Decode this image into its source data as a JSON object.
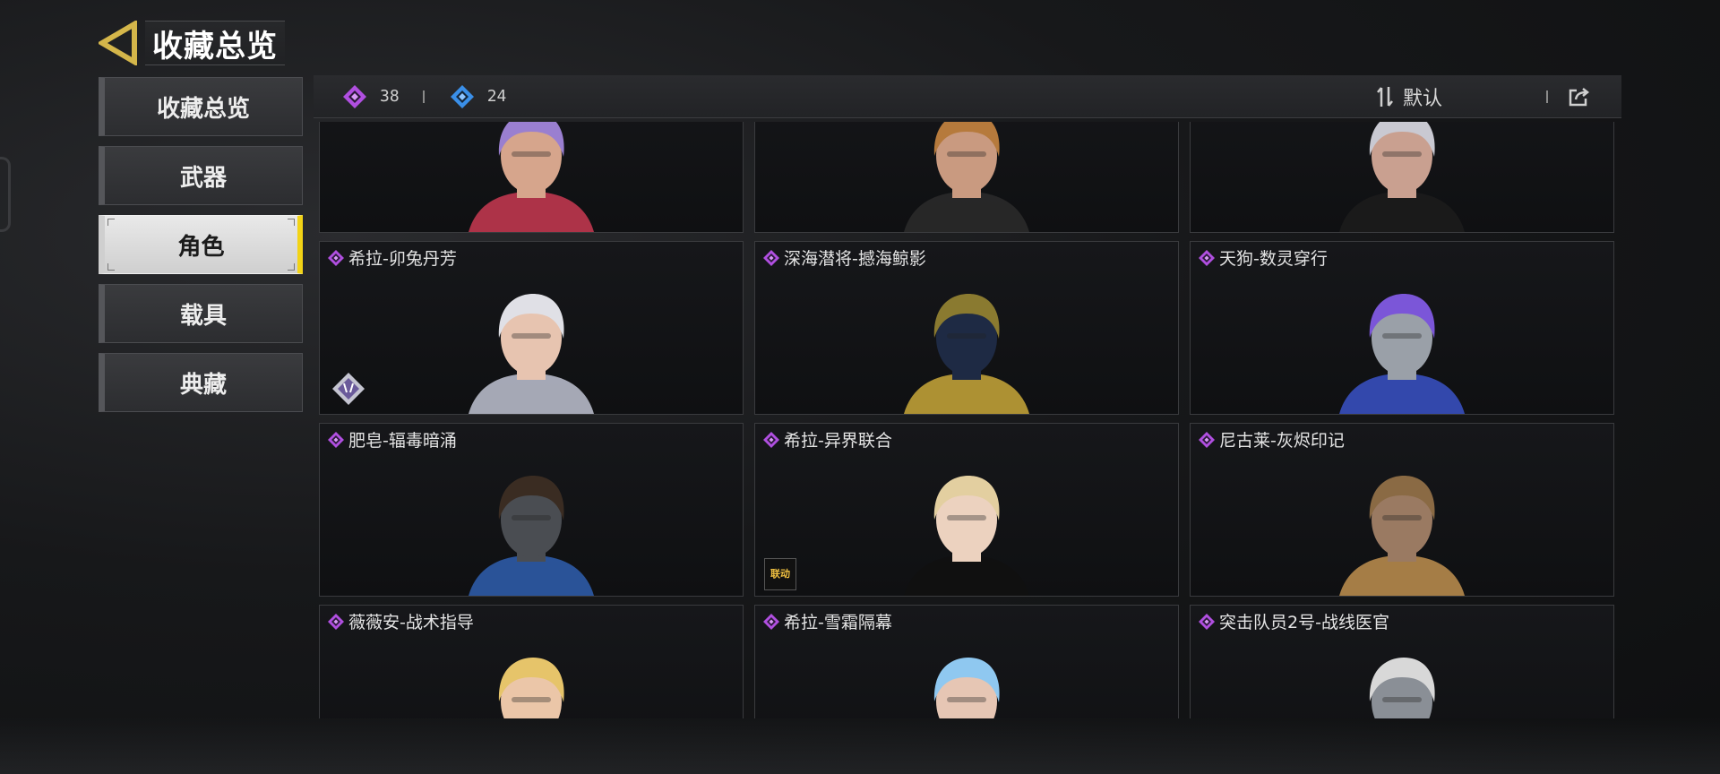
{
  "header": {
    "title": "收藏总览",
    "back_icon": "back-arrow-icon",
    "accent": "#d4b64a"
  },
  "sidebar": {
    "items": [
      {
        "label": "收藏总览",
        "active": false
      },
      {
        "label": "武器",
        "active": false
      },
      {
        "label": "角色",
        "active": true
      },
      {
        "label": "载具",
        "active": false
      },
      {
        "label": "典藏",
        "active": false
      }
    ],
    "active_color": "#f2d316"
  },
  "topbar": {
    "purple_count": "38",
    "blue_count": "24",
    "sort_label": "默认",
    "sort_icon": "sort-arrows-icon",
    "share_icon": "share-icon"
  },
  "colors": {
    "purple_rarity": "#b04fe0",
    "blue_rarity": "#3a8fe8"
  },
  "cards": [
    {
      "name": "",
      "rarity": "purple",
      "hair": "#9a7fd0",
      "skin": "#d6a58c",
      "accent": "#c93a52",
      "badge": ""
    },
    {
      "name": "",
      "rarity": "purple",
      "hair": "#b67a3c",
      "skin": "#c99a80",
      "accent": "#2b2b2b",
      "badge": ""
    },
    {
      "name": "",
      "rarity": "purple",
      "hair": "#c9c9d2",
      "skin": "#c9a090",
      "accent": "#1c1c1c",
      "badge": ""
    },
    {
      "name": "希拉-卯兔丹芳",
      "rarity": "purple",
      "hair": "#e0e0e6",
      "skin": "#e7c4b0",
      "accent": "#bfc3d2",
      "badge": "rabbit"
    },
    {
      "name": "深海潜将-撼海鲸影",
      "rarity": "purple",
      "hair": "#8a7a30",
      "skin": "#1e2a44",
      "accent": "#c9a83a",
      "badge": ""
    },
    {
      "name": "天狗-数灵穿行",
      "rarity": "purple",
      "hair": "#7b56d8",
      "skin": "#9aa0a8",
      "accent": "#3a52c8",
      "badge": ""
    },
    {
      "name": "肥皂-辐毒暗涌",
      "rarity": "purple",
      "hair": "#3a2c22",
      "skin": "#4a4d52",
      "accent": "#2f5fb0",
      "badge": ""
    },
    {
      "name": "希拉-异界联合",
      "rarity": "purple",
      "hair": "#e3cfa0",
      "skin": "#ecd2bf",
      "accent": "#111111",
      "badge": "collab"
    },
    {
      "name": "尼古莱-灰烬印记",
      "rarity": "purple",
      "hair": "#8a6a44",
      "skin": "#9a7a62",
      "accent": "#c09050",
      "badge": ""
    },
    {
      "name": "薇薇安-战术指导",
      "rarity": "purple",
      "hair": "#e6c46a",
      "skin": "#ebc6a8",
      "accent": "#b0242a",
      "badge": ""
    },
    {
      "name": "希拉-雪霜隔幕",
      "rarity": "purple",
      "hair": "#8fc8f0",
      "skin": "#e6c6b4",
      "accent": "#6c7c90",
      "badge": ""
    },
    {
      "name": "突击队员2号-战线医官",
      "rarity": "purple",
      "hair": "#d8d8d8",
      "skin": "#8a8f96",
      "accent": "#c03030",
      "badge": ""
    }
  ],
  "badge_texts": {
    "collab": "联动"
  }
}
